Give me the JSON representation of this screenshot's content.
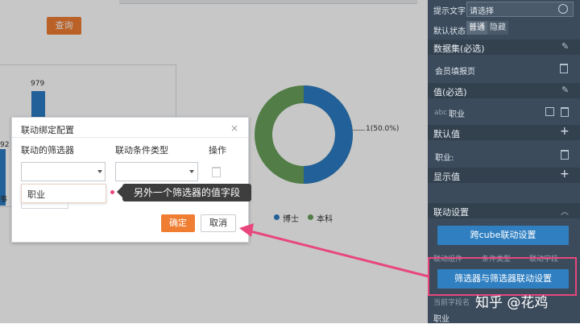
{
  "background": {
    "query_button": "查询",
    "bar_value": "979",
    "bar_side_label_top": "92",
    "bar_side_label_bottom": "事",
    "donut_label": "1(50.0%)",
    "legend": [
      {
        "label": "博士",
        "color": "#2c7bc4"
      },
      {
        "label": "本科",
        "color": "#6aa05a"
      }
    ],
    "donut_colors": {
      "blue": "#2c7bc4",
      "green": "#6aa05a"
    }
  },
  "dialog": {
    "title": "联动绑定配置",
    "close": "×",
    "col_filter": "联动的筛选器",
    "col_condition": "联动条件类型",
    "col_action": "操作",
    "dropdown_option": "职业",
    "confirm": "确定",
    "cancel": "取消"
  },
  "annotation": {
    "tooltip": "另外一个筛选器的值字段",
    "watermark": "知乎 @花鸡"
  },
  "panel": {
    "hint_text_label": "提示文字",
    "hint_text_placeholder": "请选择",
    "default_state_label": "默认状态",
    "state_normal": "普通",
    "state_hidden": "隐藏",
    "dataset_header": "数据集(必选)",
    "dataset_item": "会员填报页",
    "value_header": "值(必选)",
    "value_item_type": "abc",
    "value_item": "职业",
    "default_value_header": "默认值",
    "default_value_item": "职业:",
    "display_value_header": "显示值",
    "link_settings_header": "联动设置",
    "cube_link_button": "跨cube联动设置",
    "col_component": "联动组件",
    "col_condition_type": "条件类型",
    "col_field": "联动字段",
    "filter_link_button": "筛选器与筛选器联动设置",
    "current_field_label": "当前字段名",
    "current_field_value": "职业"
  },
  "colors": {
    "accent_orange": "#ef7d32",
    "panel_bg": "#3b4b5c",
    "panel_button": "#2f7fc1",
    "highlight_pink": "#e8467c"
  }
}
